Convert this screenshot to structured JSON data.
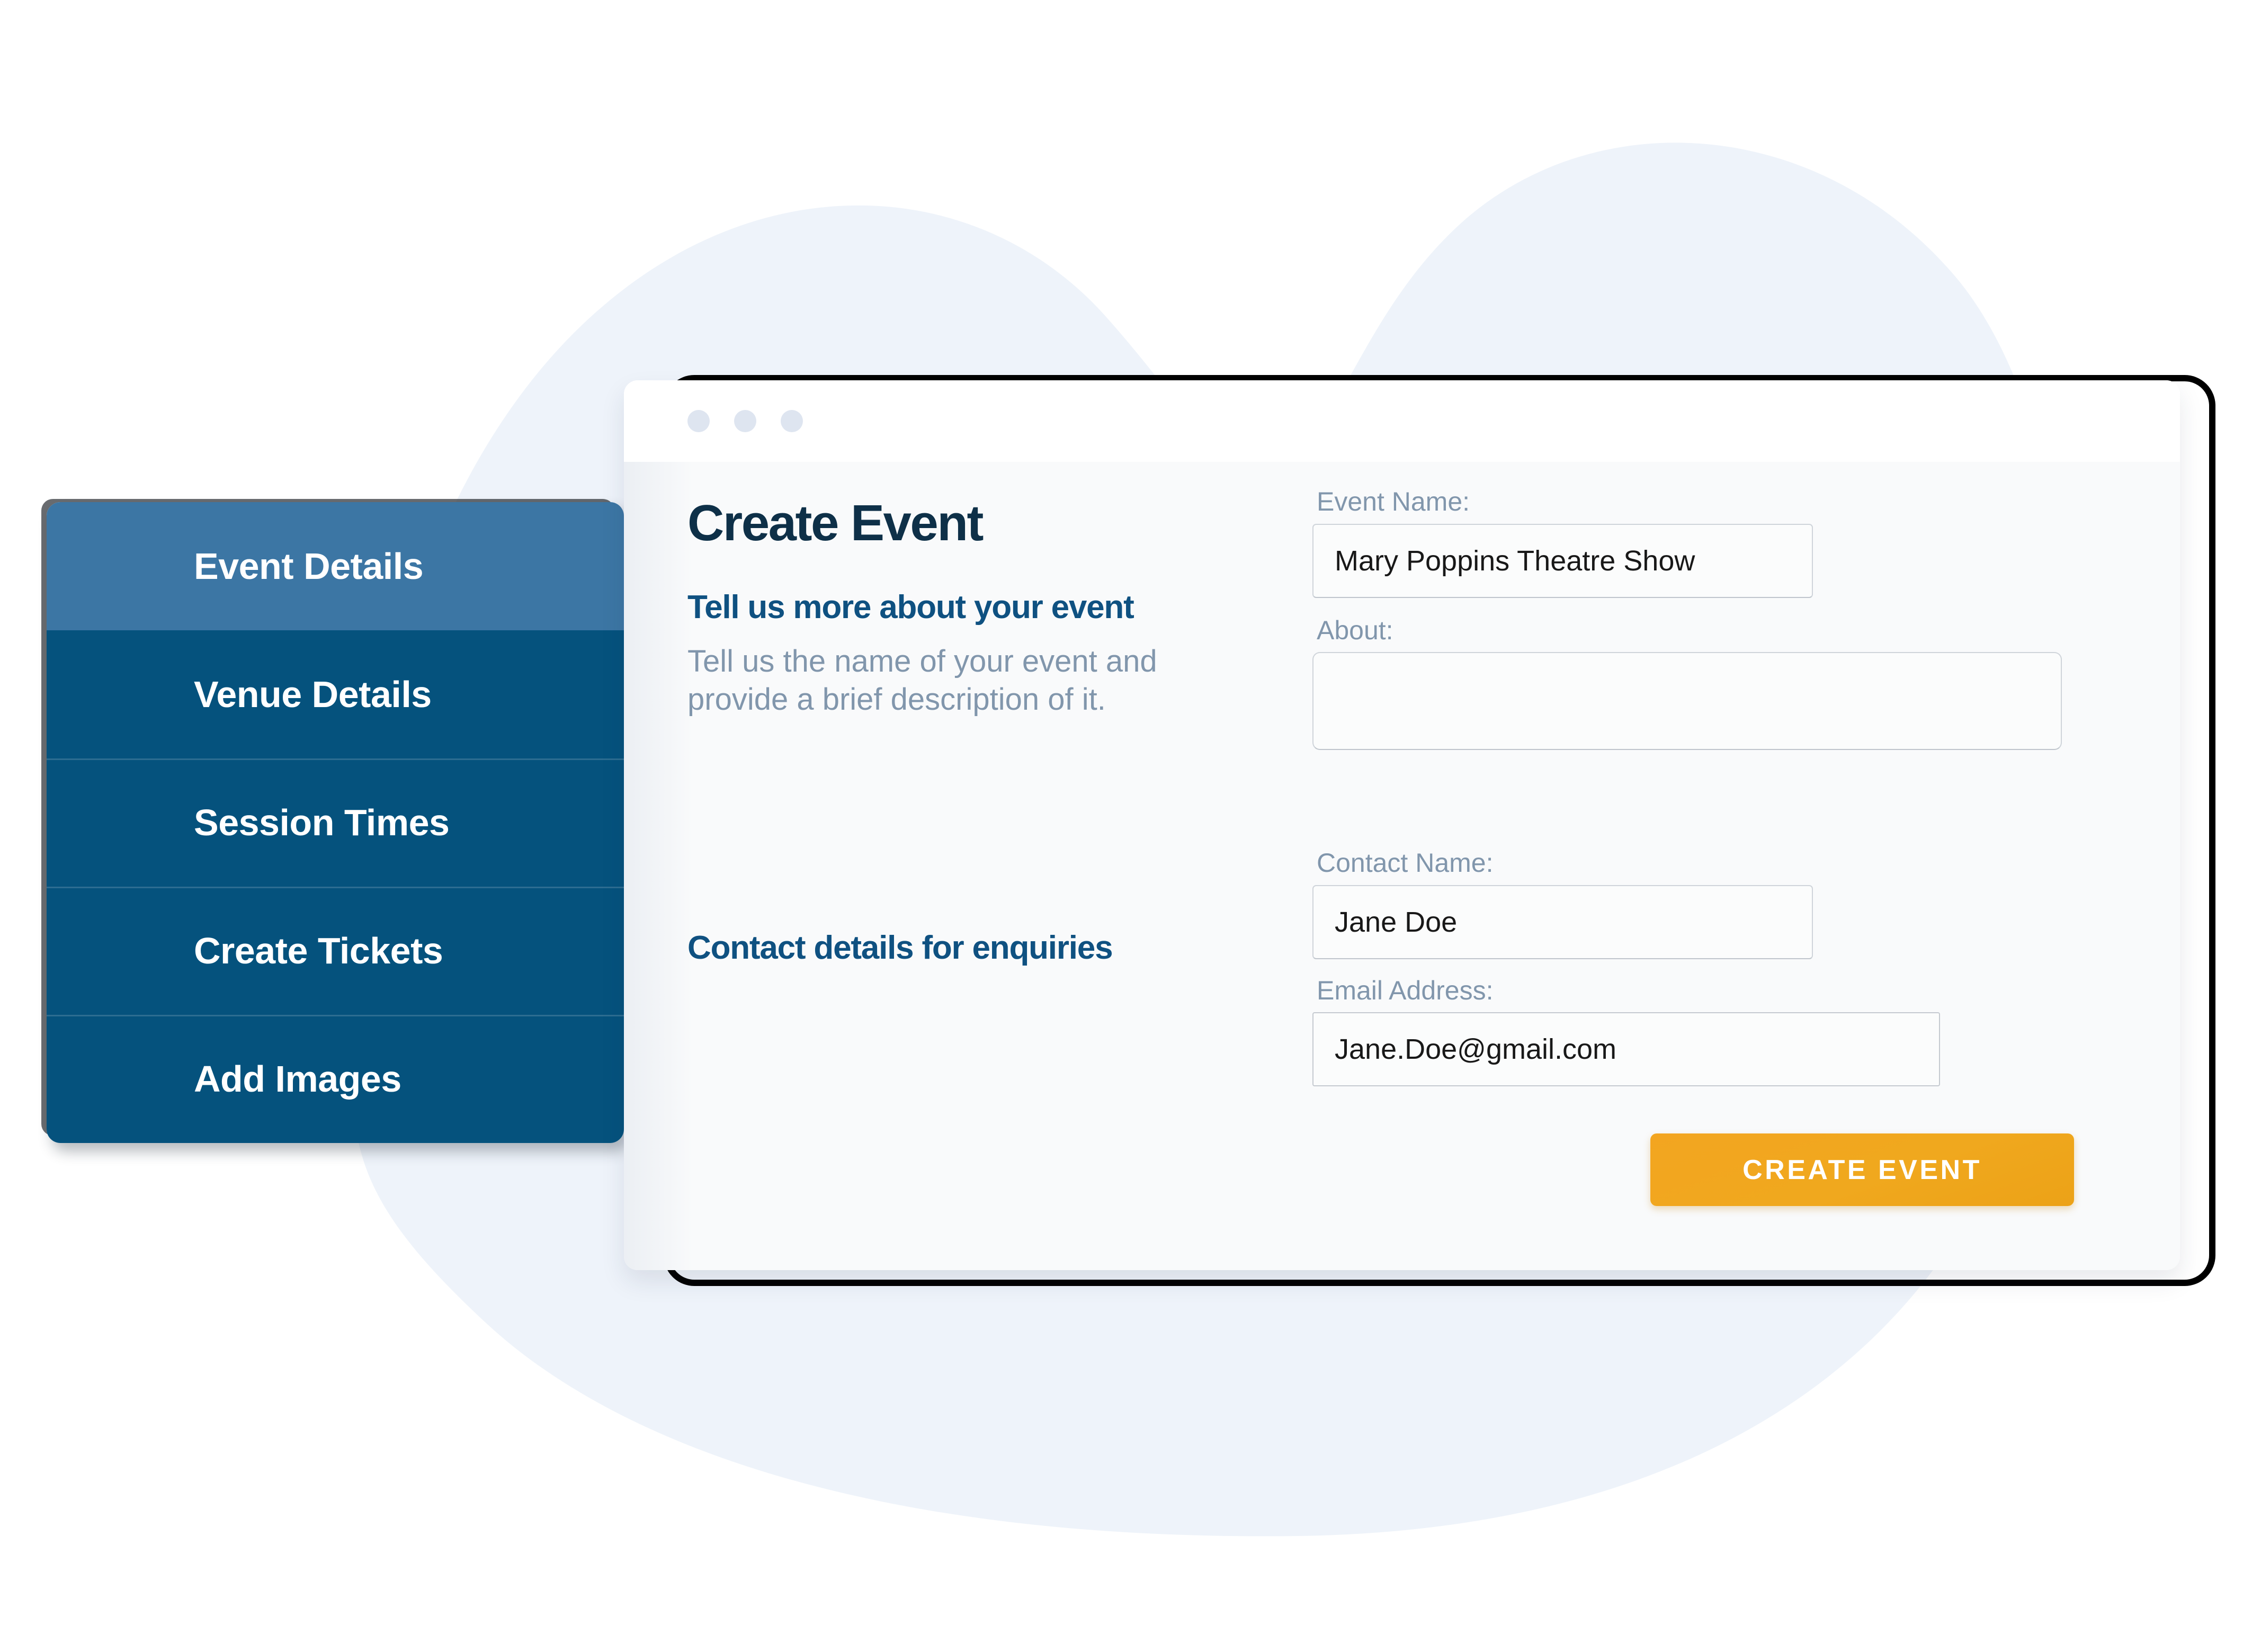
{
  "background": {
    "blob_color": "#eef3fa"
  },
  "step_nav": {
    "items": [
      {
        "label": "Event Details",
        "active": true
      },
      {
        "label": "Venue Details",
        "active": false
      },
      {
        "label": "Session Times",
        "active": false
      },
      {
        "label": "Create Tickets",
        "active": false
      },
      {
        "label": "Add Images",
        "active": false
      }
    ],
    "active_color": "#3c76a4",
    "inactive_color": "#05527d"
  },
  "window": {
    "dots": [
      "window-dot-1",
      "window-dot-2",
      "window-dot-3"
    ],
    "dot_color": "#dee5f0"
  },
  "page": {
    "title": "Create Event",
    "title_color": "#0e3048"
  },
  "sections": {
    "about": {
      "heading": "Tell us more about your event",
      "description": "Tell us the name of your event and provide a brief description of it."
    },
    "contact": {
      "heading": "Contact details for enquiries"
    },
    "heading_color": "#0f5181",
    "muted_color": "#8196ac"
  },
  "form": {
    "event_name": {
      "label": "Event Name:",
      "value": "Mary Poppins Theatre Show",
      "placeholder": ""
    },
    "about": {
      "label": "About:",
      "value": "",
      "placeholder": ""
    },
    "contact_name": {
      "label": "Contact Name:",
      "value": "Jane Doe",
      "placeholder": ""
    },
    "email_address": {
      "label": "Email Address:",
      "value": "Jane.Doe@gmail.com",
      "placeholder": ""
    }
  },
  "cta": {
    "label": "CREATE EVENT",
    "color": "#f0a81e"
  }
}
